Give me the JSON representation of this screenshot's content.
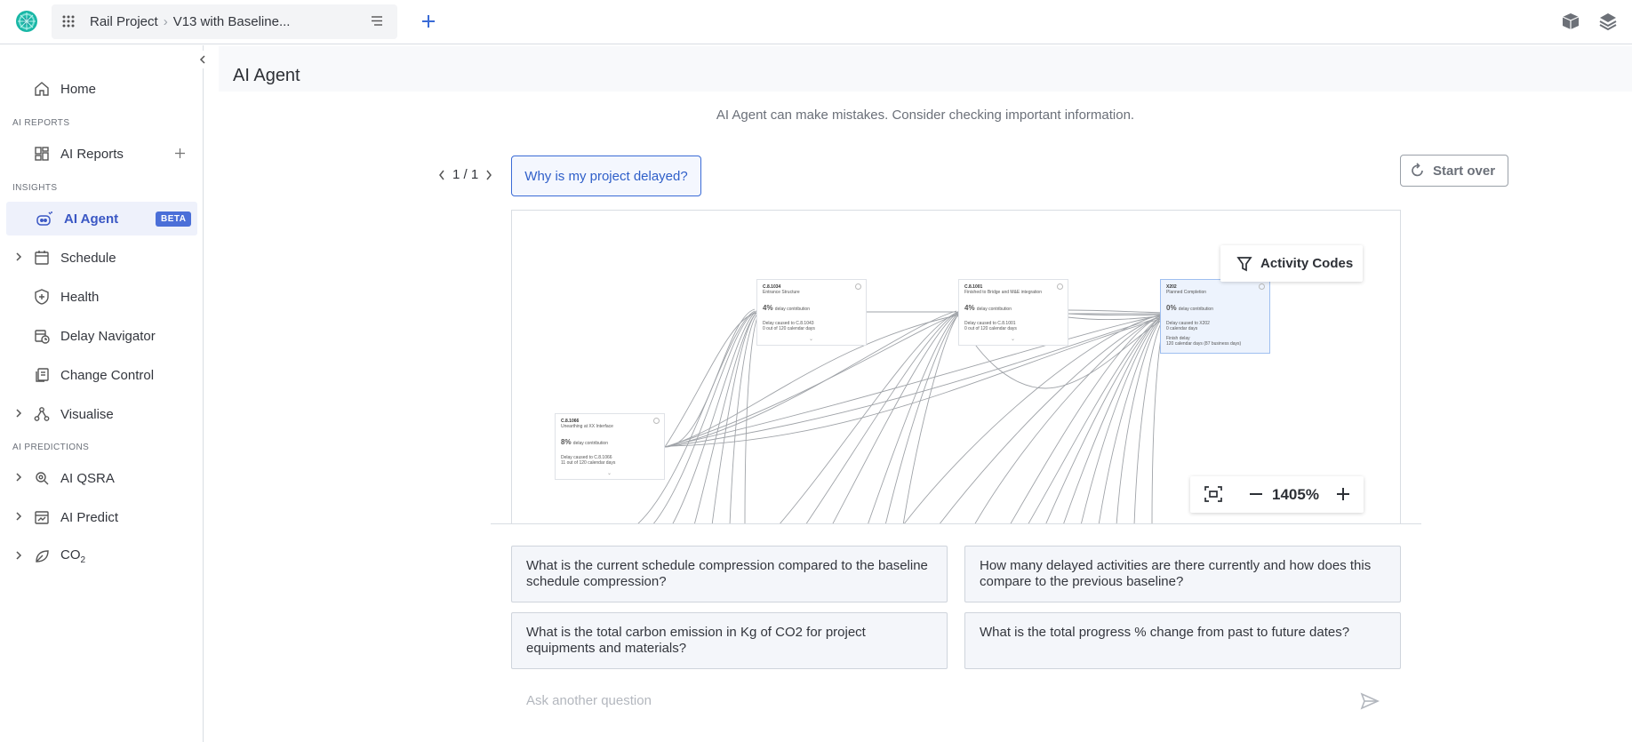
{
  "topbar": {
    "project": "Rail Project",
    "version": "V13 with Baseline..."
  },
  "sidebar": {
    "home": "Home",
    "section_ai_reports": "AI REPORTS",
    "ai_reports": "AI Reports",
    "section_insights": "INSIGHTS",
    "ai_agent": "AI Agent",
    "beta": "BETA",
    "schedule": "Schedule",
    "health": "Health",
    "delay_navigator": "Delay Navigator",
    "change_control": "Change Control",
    "visualise": "Visualise",
    "section_ai_predictions": "AI PREDICTIONS",
    "ai_qsra": "AI QSRA",
    "ai_predict": "AI Predict",
    "co2_main": "CO",
    "co2_sub": "2"
  },
  "main": {
    "title": "AI Agent",
    "disclaimer": "AI Agent can make mistakes. Consider checking important information.",
    "pager": "1 / 1",
    "question": "Why is my project delayed?",
    "start_over": "Start over",
    "activity_codes": "Activity Codes",
    "zoom": "1405%"
  },
  "nodes": [
    {
      "id": "C.8.1034",
      "name": "Entrance Structure",
      "pct": "4%",
      "pct_label": "delay contribution",
      "line1": "Delay caused to C.8.1043",
      "line2": "0 out of 120 calendar days"
    },
    {
      "id": "C.8.1001",
      "name": "Finished to Bridge and M&E integration",
      "pct": "4%",
      "pct_label": "delay contribution",
      "line1": "Delay caused to C.8.1001",
      "line2": "0 out of 120 calendar days"
    },
    {
      "id": "X202",
      "name": "Planned Completion",
      "pct": "0%",
      "pct_label": "delay contribution",
      "line1": "Delay caused to X202",
      "line2": "0 calendar days",
      "line3": "Finish delay",
      "line4": "120 calendar days (87 business days)"
    },
    {
      "id": "C.8.1066",
      "name": "Unearthing at XX Interface",
      "pct": "8%",
      "pct_label": "delay contribution",
      "line1": "Delay caused to C.8.1066",
      "line2": "11 out of 120 calendar days"
    }
  ],
  "suggestions": [
    "What is the current schedule compression compared to the baseline schedule compression?",
    "How many delayed activities are there currently and how does this compare to the previous baseline?",
    "What is the total carbon emission in Kg of CO2 for project equipments and materials?",
    "What is the total progress % change from past to future dates?"
  ],
  "input": {
    "placeholder": "Ask another question"
  },
  "colors": {
    "accent": "#3a6bd6",
    "beta_bg": "#4b6fd8",
    "active_bg": "#eef1fb",
    "edge": "#8f9399"
  }
}
